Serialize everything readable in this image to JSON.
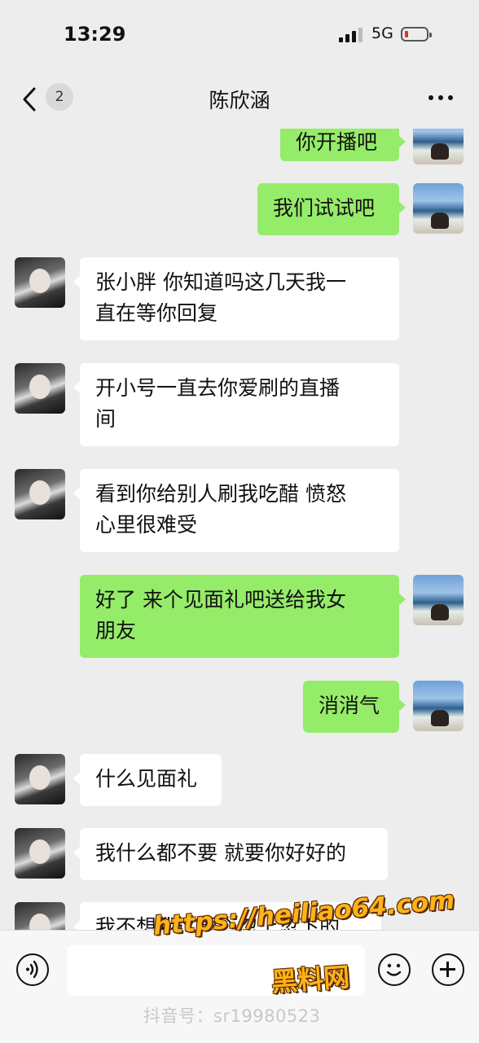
{
  "status_bar": {
    "time": "13:29",
    "network": "5G"
  },
  "nav": {
    "unread_count": "2",
    "title": "陈欣涵"
  },
  "messages": [
    {
      "side": "right",
      "text": "你开播吧"
    },
    {
      "side": "right",
      "text": "我们试试吧"
    },
    {
      "side": "left",
      "text": "张小胖 你知道吗这几天我一\n直在等你回复"
    },
    {
      "side": "left",
      "text": "开小号一直去你爱刷的直播\n间"
    },
    {
      "side": "left",
      "text": "看到你给别人刷我吃醋 愤怒\n心里很难受"
    },
    {
      "side": "right",
      "text": "好了 来个见面礼吧送给我女\n朋友"
    },
    {
      "side": "right",
      "text": "消消气"
    },
    {
      "side": "left",
      "text": "什么见面礼"
    },
    {
      "side": "left",
      "text": "我什么都不要 就要你好好的"
    },
    {
      "side": "left",
      "text": "我不想我这颗心忽上忽下的"
    }
  ],
  "input_bar": {
    "placeholder": ""
  },
  "watermark": {
    "url": "https://heiliao64.com",
    "site_name": "黑料网",
    "douyin_id": "抖音号：sr19980523"
  },
  "colors": {
    "background": "#ededed",
    "bubble_sent": "#95ec69",
    "bubble_received": "#ffffff"
  }
}
